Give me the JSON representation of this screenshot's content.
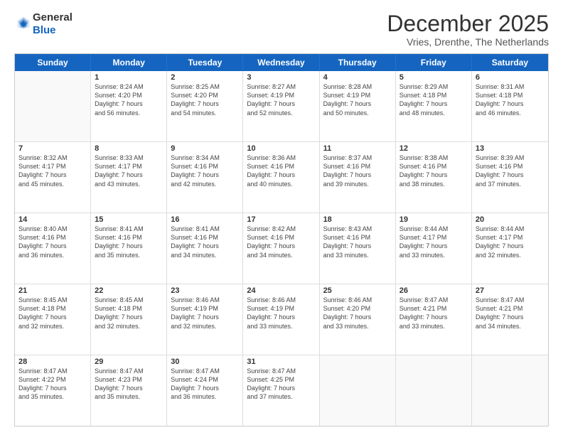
{
  "logo": {
    "general": "General",
    "blue": "Blue"
  },
  "title": "December 2025",
  "location": "Vries, Drenthe, The Netherlands",
  "days": [
    "Sunday",
    "Monday",
    "Tuesday",
    "Wednesday",
    "Thursday",
    "Friday",
    "Saturday"
  ],
  "weeks": [
    [
      {
        "day": "",
        "sunrise": "",
        "sunset": "",
        "daylight": "",
        "empty": true
      },
      {
        "day": "1",
        "sunrise": "Sunrise: 8:24 AM",
        "sunset": "Sunset: 4:20 PM",
        "daylight": "Daylight: 7 hours",
        "daylight2": "and 56 minutes."
      },
      {
        "day": "2",
        "sunrise": "Sunrise: 8:25 AM",
        "sunset": "Sunset: 4:20 PM",
        "daylight": "Daylight: 7 hours",
        "daylight2": "and 54 minutes."
      },
      {
        "day": "3",
        "sunrise": "Sunrise: 8:27 AM",
        "sunset": "Sunset: 4:19 PM",
        "daylight": "Daylight: 7 hours",
        "daylight2": "and 52 minutes."
      },
      {
        "day": "4",
        "sunrise": "Sunrise: 8:28 AM",
        "sunset": "Sunset: 4:19 PM",
        "daylight": "Daylight: 7 hours",
        "daylight2": "and 50 minutes."
      },
      {
        "day": "5",
        "sunrise": "Sunrise: 8:29 AM",
        "sunset": "Sunset: 4:18 PM",
        "daylight": "Daylight: 7 hours",
        "daylight2": "and 48 minutes."
      },
      {
        "day": "6",
        "sunrise": "Sunrise: 8:31 AM",
        "sunset": "Sunset: 4:18 PM",
        "daylight": "Daylight: 7 hours",
        "daylight2": "and 46 minutes."
      }
    ],
    [
      {
        "day": "7",
        "sunrise": "Sunrise: 8:32 AM",
        "sunset": "Sunset: 4:17 PM",
        "daylight": "Daylight: 7 hours",
        "daylight2": "and 45 minutes."
      },
      {
        "day": "8",
        "sunrise": "Sunrise: 8:33 AM",
        "sunset": "Sunset: 4:17 PM",
        "daylight": "Daylight: 7 hours",
        "daylight2": "and 43 minutes."
      },
      {
        "day": "9",
        "sunrise": "Sunrise: 8:34 AM",
        "sunset": "Sunset: 4:16 PM",
        "daylight": "Daylight: 7 hours",
        "daylight2": "and 42 minutes."
      },
      {
        "day": "10",
        "sunrise": "Sunrise: 8:36 AM",
        "sunset": "Sunset: 4:16 PM",
        "daylight": "Daylight: 7 hours",
        "daylight2": "and 40 minutes."
      },
      {
        "day": "11",
        "sunrise": "Sunrise: 8:37 AM",
        "sunset": "Sunset: 4:16 PM",
        "daylight": "Daylight: 7 hours",
        "daylight2": "and 39 minutes."
      },
      {
        "day": "12",
        "sunrise": "Sunrise: 8:38 AM",
        "sunset": "Sunset: 4:16 PM",
        "daylight": "Daylight: 7 hours",
        "daylight2": "and 38 minutes."
      },
      {
        "day": "13",
        "sunrise": "Sunrise: 8:39 AM",
        "sunset": "Sunset: 4:16 PM",
        "daylight": "Daylight: 7 hours",
        "daylight2": "and 37 minutes."
      }
    ],
    [
      {
        "day": "14",
        "sunrise": "Sunrise: 8:40 AM",
        "sunset": "Sunset: 4:16 PM",
        "daylight": "Daylight: 7 hours",
        "daylight2": "and 36 minutes."
      },
      {
        "day": "15",
        "sunrise": "Sunrise: 8:41 AM",
        "sunset": "Sunset: 4:16 PM",
        "daylight": "Daylight: 7 hours",
        "daylight2": "and 35 minutes."
      },
      {
        "day": "16",
        "sunrise": "Sunrise: 8:41 AM",
        "sunset": "Sunset: 4:16 PM",
        "daylight": "Daylight: 7 hours",
        "daylight2": "and 34 minutes."
      },
      {
        "day": "17",
        "sunrise": "Sunrise: 8:42 AM",
        "sunset": "Sunset: 4:16 PM",
        "daylight": "Daylight: 7 hours",
        "daylight2": "and 34 minutes."
      },
      {
        "day": "18",
        "sunrise": "Sunrise: 8:43 AM",
        "sunset": "Sunset: 4:16 PM",
        "daylight": "Daylight: 7 hours",
        "daylight2": "and 33 minutes."
      },
      {
        "day": "19",
        "sunrise": "Sunrise: 8:44 AM",
        "sunset": "Sunset: 4:17 PM",
        "daylight": "Daylight: 7 hours",
        "daylight2": "and 33 minutes."
      },
      {
        "day": "20",
        "sunrise": "Sunrise: 8:44 AM",
        "sunset": "Sunset: 4:17 PM",
        "daylight": "Daylight: 7 hours",
        "daylight2": "and 32 minutes."
      }
    ],
    [
      {
        "day": "21",
        "sunrise": "Sunrise: 8:45 AM",
        "sunset": "Sunset: 4:18 PM",
        "daylight": "Daylight: 7 hours",
        "daylight2": "and 32 minutes."
      },
      {
        "day": "22",
        "sunrise": "Sunrise: 8:45 AM",
        "sunset": "Sunset: 4:18 PM",
        "daylight": "Daylight: 7 hours",
        "daylight2": "and 32 minutes."
      },
      {
        "day": "23",
        "sunrise": "Sunrise: 8:46 AM",
        "sunset": "Sunset: 4:19 PM",
        "daylight": "Daylight: 7 hours",
        "daylight2": "and 32 minutes."
      },
      {
        "day": "24",
        "sunrise": "Sunrise: 8:46 AM",
        "sunset": "Sunset: 4:19 PM",
        "daylight": "Daylight: 7 hours",
        "daylight2": "and 33 minutes."
      },
      {
        "day": "25",
        "sunrise": "Sunrise: 8:46 AM",
        "sunset": "Sunset: 4:20 PM",
        "daylight": "Daylight: 7 hours",
        "daylight2": "and 33 minutes."
      },
      {
        "day": "26",
        "sunrise": "Sunrise: 8:47 AM",
        "sunset": "Sunset: 4:21 PM",
        "daylight": "Daylight: 7 hours",
        "daylight2": "and 33 minutes."
      },
      {
        "day": "27",
        "sunrise": "Sunrise: 8:47 AM",
        "sunset": "Sunset: 4:21 PM",
        "daylight": "Daylight: 7 hours",
        "daylight2": "and 34 minutes."
      }
    ],
    [
      {
        "day": "28",
        "sunrise": "Sunrise: 8:47 AM",
        "sunset": "Sunset: 4:22 PM",
        "daylight": "Daylight: 7 hours",
        "daylight2": "and 35 minutes."
      },
      {
        "day": "29",
        "sunrise": "Sunrise: 8:47 AM",
        "sunset": "Sunset: 4:23 PM",
        "daylight": "Daylight: 7 hours",
        "daylight2": "and 35 minutes."
      },
      {
        "day": "30",
        "sunrise": "Sunrise: 8:47 AM",
        "sunset": "Sunset: 4:24 PM",
        "daylight": "Daylight: 7 hours",
        "daylight2": "and 36 minutes."
      },
      {
        "day": "31",
        "sunrise": "Sunrise: 8:47 AM",
        "sunset": "Sunset: 4:25 PM",
        "daylight": "Daylight: 7 hours",
        "daylight2": "and 37 minutes."
      },
      {
        "day": "",
        "sunrise": "",
        "sunset": "",
        "daylight": "",
        "empty": true
      },
      {
        "day": "",
        "sunrise": "",
        "sunset": "",
        "daylight": "",
        "empty": true
      },
      {
        "day": "",
        "sunrise": "",
        "sunset": "",
        "daylight": "",
        "empty": true
      }
    ]
  ]
}
